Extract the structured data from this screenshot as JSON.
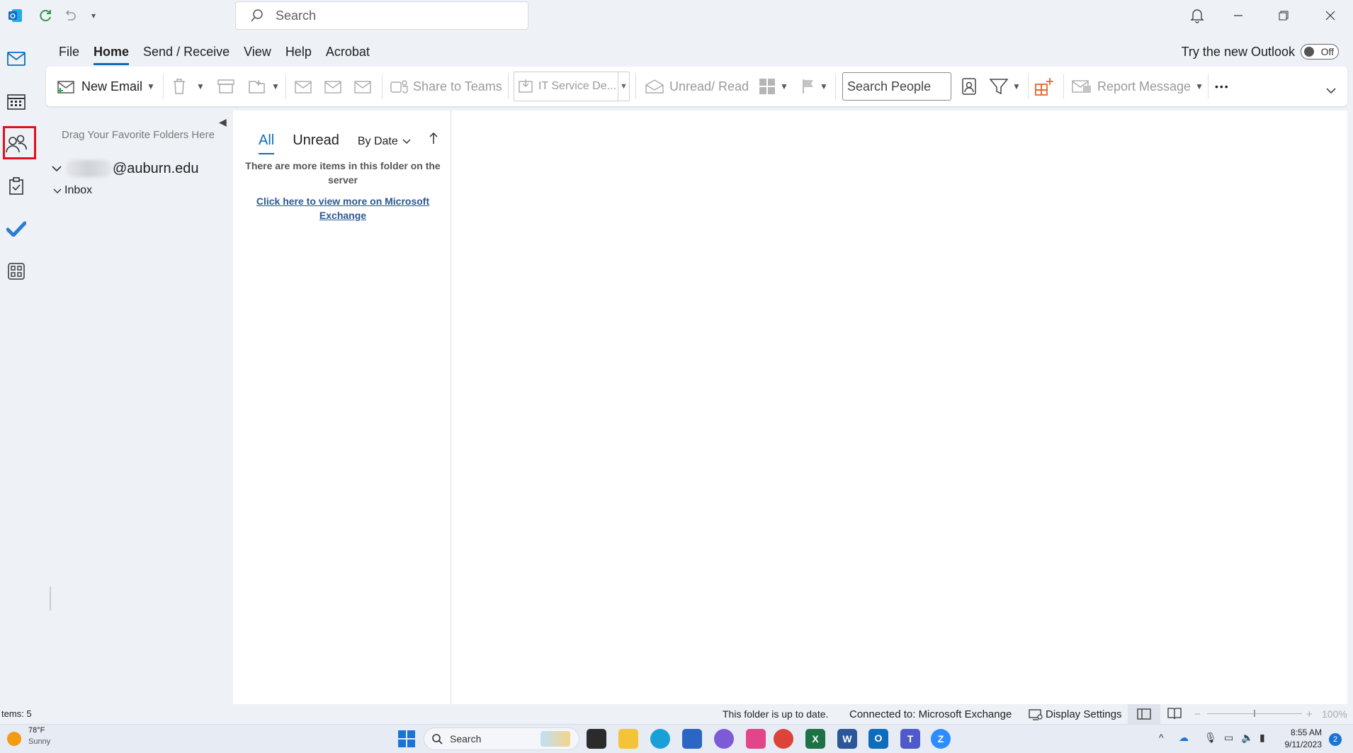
{
  "titlebar": {
    "search_placeholder": "Search"
  },
  "menu": {
    "items": [
      "File",
      "Home",
      "Send / Receive",
      "View",
      "Help",
      "Acrobat"
    ],
    "active": "Home",
    "try_new": "Try the new Outlook",
    "toggle_state": "Off"
  },
  "ribbon": {
    "new_email": "New Email",
    "share_to_teams": "Share to Teams",
    "it_service_desk": "IT Service De...",
    "unread_read": "Unread/ Read",
    "search_people_placeholder": "Search People",
    "report_message": "Report Message",
    "more": "•••"
  },
  "folder_pane": {
    "favorites_hint": "Drag Your Favorite Folders Here",
    "account_suffix": "@auburn.edu",
    "inbox": "Inbox"
  },
  "message_list": {
    "tab_all": "All",
    "tab_unread": "Unread",
    "sort_label": "By Date",
    "more_items_notice": "There are more items in this folder on the server",
    "exchange_link": "Click here to view more on Microsoft Exchange"
  },
  "statusbar": {
    "items_count": "tems: 5",
    "folder_status": "This folder is up to date.",
    "connection": "Connected to: Microsoft Exchange",
    "display_settings": "Display Settings",
    "zoom": "100%"
  },
  "taskbar": {
    "weather_temp": "78°F",
    "weather_desc": "Sunny",
    "search_label": "Search",
    "time": "8:55 AM",
    "date": "9/11/2023",
    "notification_count": "2"
  },
  "colors": {
    "accent": "#0f6cbd",
    "highlight": "#e3101d",
    "outlook_blue": "#0f6cbd"
  }
}
